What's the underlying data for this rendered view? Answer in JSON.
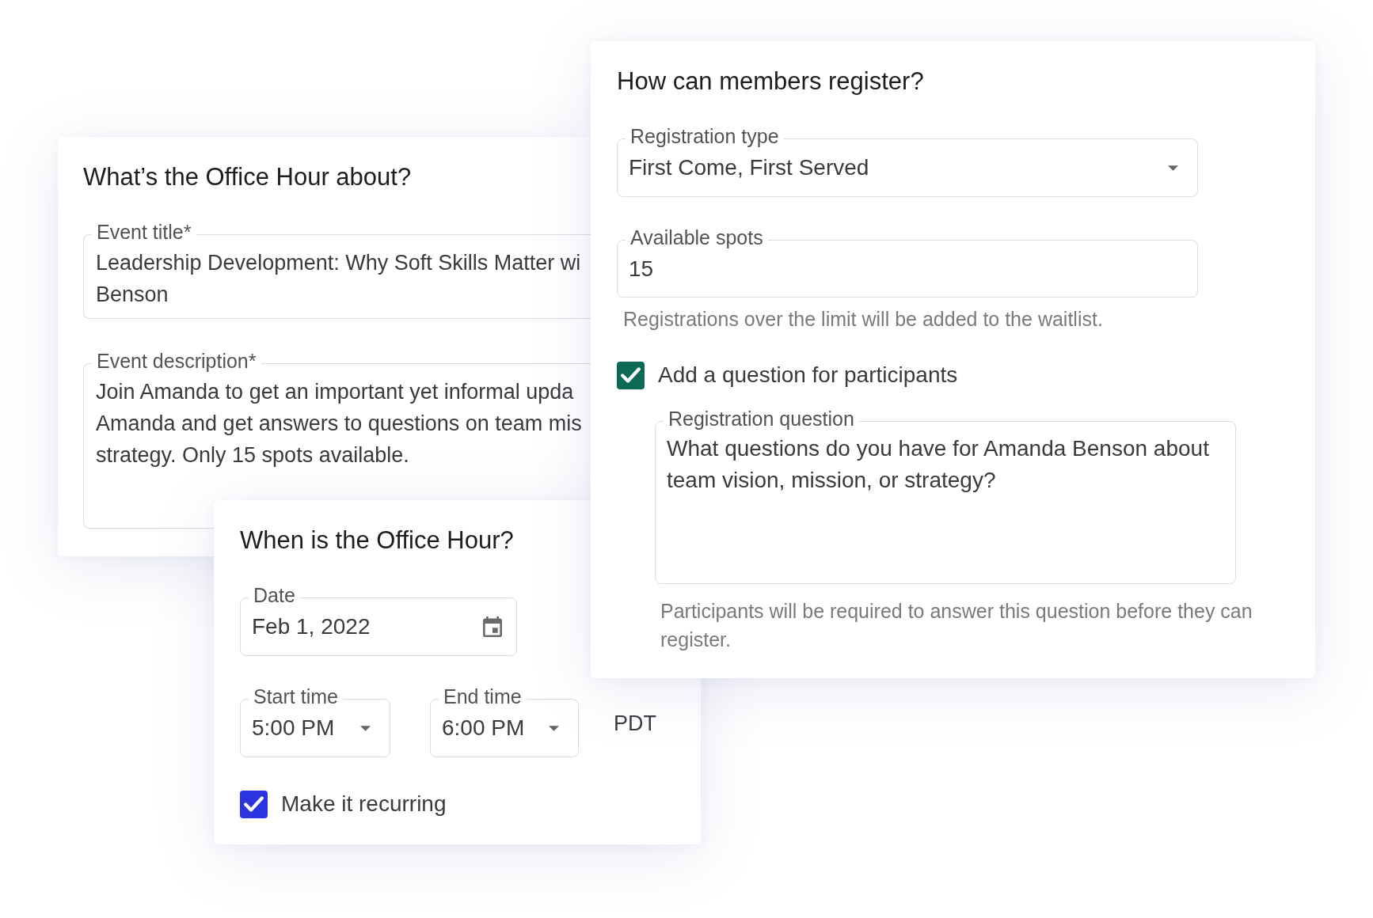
{
  "about_card": {
    "title": "What’s the Office Hour about?",
    "event_title": {
      "label": "Event title*",
      "value_lines": [
        "Leadership Development: Why Soft Skills Matter wi",
        "Benson"
      ]
    },
    "event_description": {
      "label": "Event description*",
      "value_lines": [
        "Join Amanda to get an important yet informal upda",
        "Amanda and get answers to questions on team mis",
        "strategy. Only 15 spots available."
      ]
    }
  },
  "when_card": {
    "title": "When is the Office Hour?",
    "date": {
      "label": "Date",
      "value": "Feb 1, 2022"
    },
    "start_time": {
      "label": "Start time",
      "value": "5:00 PM"
    },
    "end_time": {
      "label": "End time",
      "value": "6:00 PM"
    },
    "timezone": "PDT",
    "recurring": {
      "label": "Make it recurring",
      "checked": true
    }
  },
  "register_card": {
    "title": "How can members register?",
    "registration_type": {
      "label": "Registration type",
      "value": "First Come, First Served"
    },
    "available_spots": {
      "label": "Available spots",
      "value": "15",
      "helper": "Registrations over the limit will be added to the waitlist."
    },
    "add_question": {
      "label": "Add a question for participants",
      "checked": true
    },
    "registration_question": {
      "label": "Registration question",
      "value": "What questions do you have for Amanda Benson about team vision, mission, or strategy?",
      "helper": "Participants will be required to answer this question before they can register."
    }
  }
}
